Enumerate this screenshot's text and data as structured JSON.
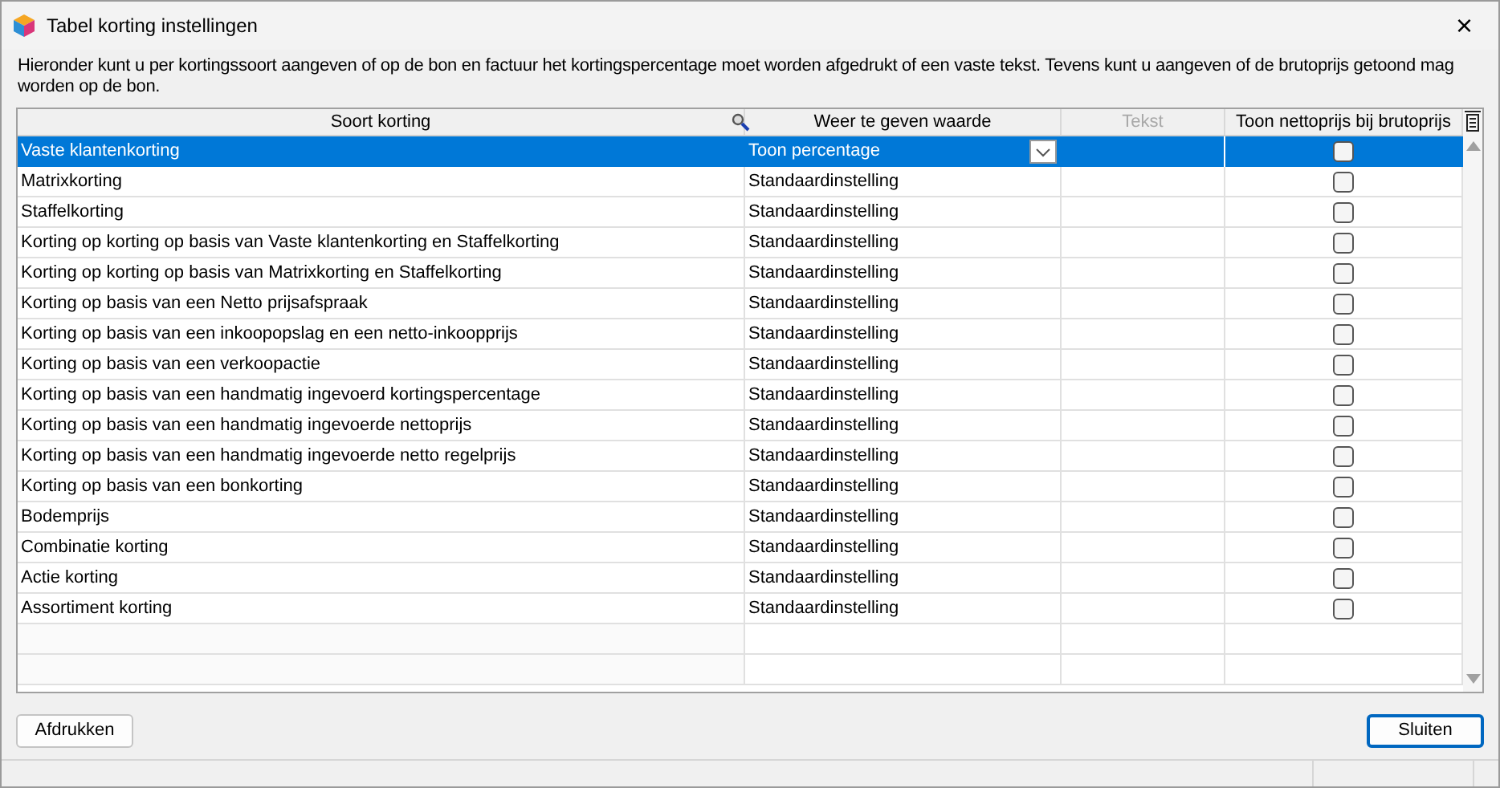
{
  "window": {
    "title": "Tabel korting instellingen",
    "close": "×"
  },
  "description": "Hieronder kunt u per kortingssoort aangeven of op de bon en factuur het kortingspercentage moet worden afgedrukt of een vaste tekst. Tevens kunt u aangeven of de brutoprijs getoond mag worden op de bon.",
  "table": {
    "columns": [
      {
        "label": "Soort korting",
        "disabled": false
      },
      {
        "label": "Weer te geven waarde",
        "disabled": false
      },
      {
        "label": "Tekst",
        "disabled": true
      },
      {
        "label": "Toon nettoprijs bij brutoprijs",
        "disabled": false
      }
    ],
    "rows": [
      {
        "name": "Vaste klantenkorting",
        "value": "Toon percentage",
        "checked": false,
        "selected": true
      },
      {
        "name": "Matrixkorting",
        "value": "Standaardinstelling",
        "checked": false,
        "selected": false
      },
      {
        "name": "Staffelkorting",
        "value": "Standaardinstelling",
        "checked": false,
        "selected": false
      },
      {
        "name": "Korting op korting op basis van Vaste klantenkorting en Staffelkorting",
        "value": "Standaardinstelling",
        "checked": false,
        "selected": false
      },
      {
        "name": "Korting op korting op basis van Matrixkorting en Staffelkorting",
        "value": "Standaardinstelling",
        "checked": false,
        "selected": false
      },
      {
        "name": "Korting op basis van een Netto prijsafspraak",
        "value": "Standaardinstelling",
        "checked": false,
        "selected": false
      },
      {
        "name": "Korting op basis van een inkoopopslag en een netto-inkoopprijs",
        "value": "Standaardinstelling",
        "checked": false,
        "selected": false
      },
      {
        "name": "Korting op basis van een verkoopactie",
        "value": "Standaardinstelling",
        "checked": false,
        "selected": false
      },
      {
        "name": "Korting op basis van een handmatig ingevoerd kortingspercentage",
        "value": "Standaardinstelling",
        "checked": false,
        "selected": false
      },
      {
        "name": "Korting op basis van een handmatig ingevoerde nettoprijs",
        "value": "Standaardinstelling",
        "checked": false,
        "selected": false
      },
      {
        "name": "Korting op basis van een handmatig ingevoerde netto regelprijs",
        "value": "Standaardinstelling",
        "checked": false,
        "selected": false
      },
      {
        "name": "Korting op basis van een bonkorting",
        "value": "Standaardinstelling",
        "checked": false,
        "selected": false
      },
      {
        "name": "Bodemprijs",
        "value": "Standaardinstelling",
        "checked": false,
        "selected": false
      },
      {
        "name": "Combinatie korting",
        "value": "Standaardinstelling",
        "checked": false,
        "selected": false
      },
      {
        "name": "Actie korting",
        "value": "Standaardinstelling",
        "checked": false,
        "selected": false
      },
      {
        "name": "Assortiment korting",
        "value": "Standaardinstelling",
        "checked": false,
        "selected": false
      }
    ]
  },
  "buttons": [
    {
      "label": "Afdrukken",
      "default": false
    },
    {
      "label": "Sluiten",
      "default": true
    }
  ]
}
